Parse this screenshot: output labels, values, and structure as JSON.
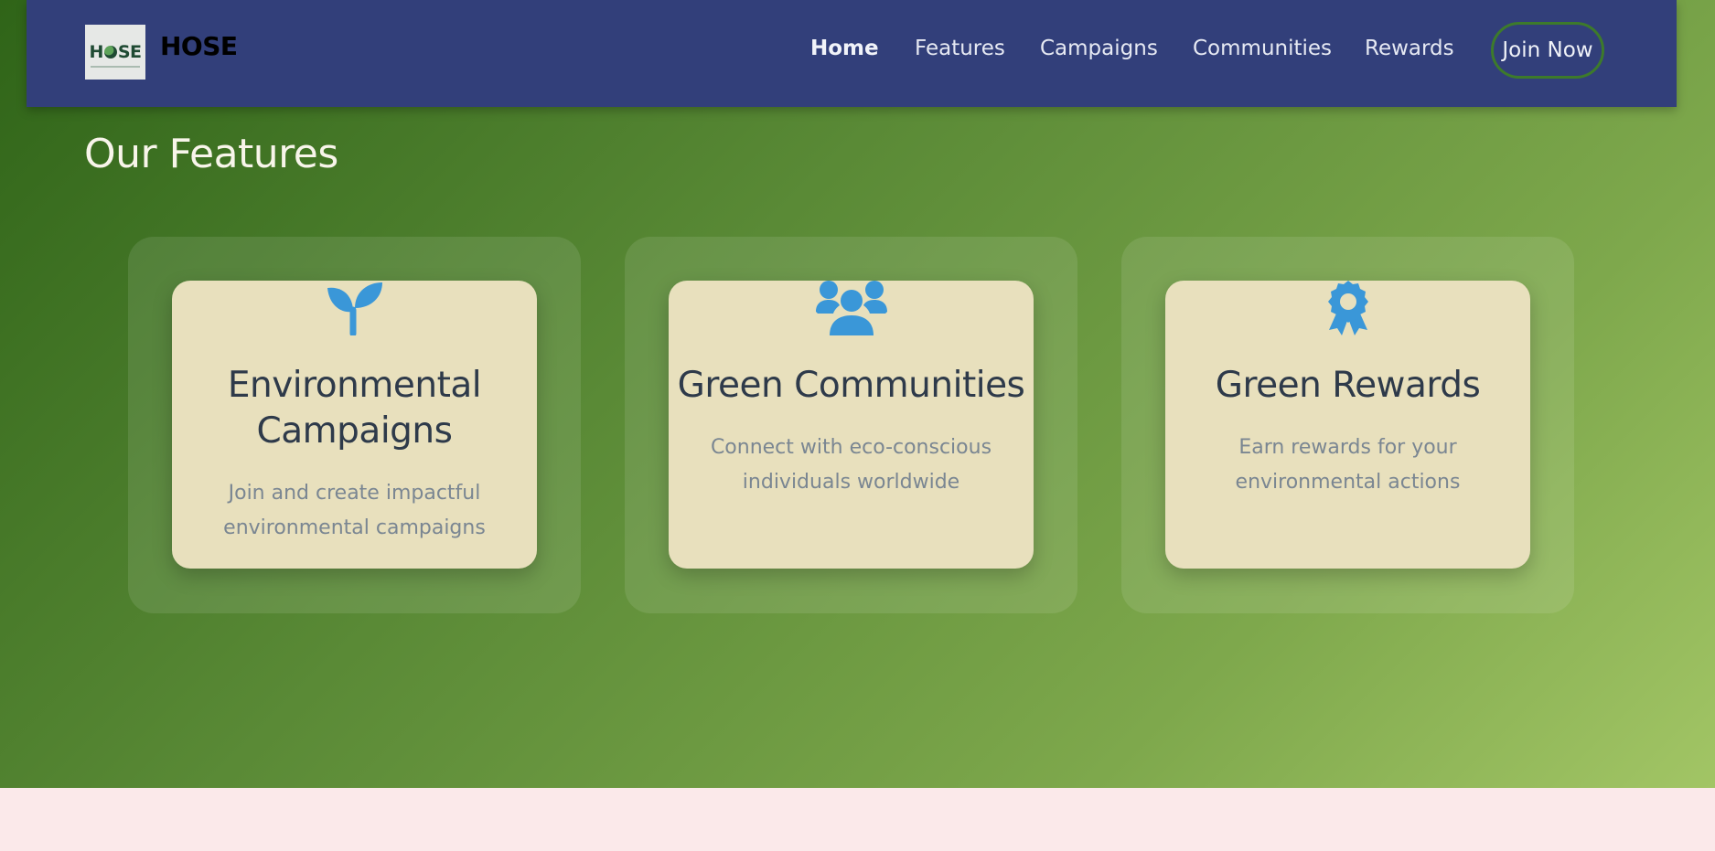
{
  "navbar": {
    "logo_text": "HOSE",
    "brand": "HOSE",
    "links": [
      {
        "label": "Home",
        "active": true
      },
      {
        "label": "Features",
        "active": false
      },
      {
        "label": "Campaigns",
        "active": false
      },
      {
        "label": "Communities",
        "active": false
      },
      {
        "label": "Rewards",
        "active": false
      }
    ],
    "cta_label": "Join Now"
  },
  "features": {
    "title": "Our Features",
    "cards": [
      {
        "icon": "seedling-icon",
        "title": "Environmental Campaigns",
        "description": "Join and create impactful environmental campaigns"
      },
      {
        "icon": "users-icon",
        "title": "Green Communities",
        "description": "Connect with eco-conscious individuals worldwide"
      },
      {
        "icon": "award-icon",
        "title": "Green Rewards",
        "description": "Earn rewards for your environmental actions"
      }
    ]
  },
  "colors": {
    "navbar_bg": "#323f7a",
    "icon_blue": "#3a97d8",
    "card_bg": "#e8e0bd",
    "cta_border": "#3d7a2b",
    "footer_bg": "#fbe9ea"
  }
}
